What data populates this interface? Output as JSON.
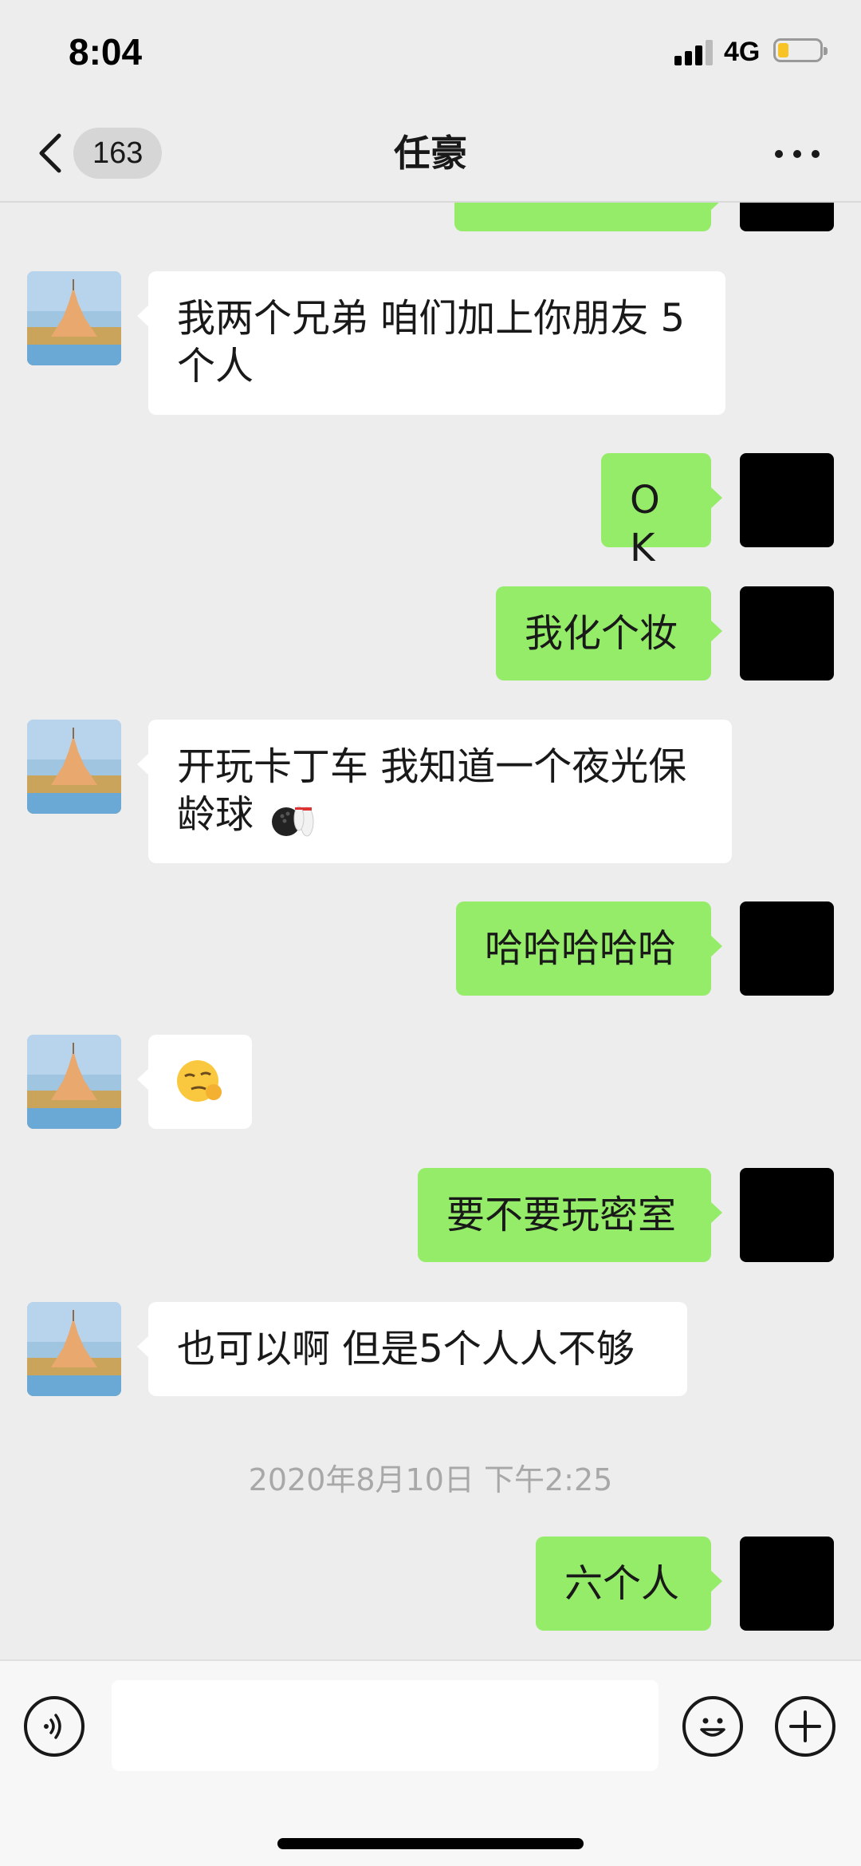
{
  "status_bar": {
    "time": "8:04",
    "network": "4G",
    "battery_level_fraction": 0.25,
    "battery_color": "#f7c325"
  },
  "nav": {
    "unread_count": "163",
    "title": "任豪",
    "back_icon": "chevron-left-icon",
    "more_icon": "more-dots-icon"
  },
  "messages": [
    {
      "side": "in",
      "text": "我两个兄弟 咱们加上你朋友 5个人"
    },
    {
      "side": "out",
      "text": "OK"
    },
    {
      "side": "out",
      "text": "我化个妆"
    },
    {
      "side": "in",
      "text": "开玩卡丁车 我知道一个夜光保龄球",
      "emoji": "bowling-emoji"
    },
    {
      "side": "out",
      "text": "哈哈哈哈哈"
    },
    {
      "side": "in",
      "emoji": "smirk-face-emoji"
    },
    {
      "side": "out",
      "text": "要不要玩密室"
    },
    {
      "side": "in",
      "text": "也可以啊 但是5个人人不够"
    },
    {
      "side": "out",
      "text": "六个人"
    }
  ],
  "timestamp": "2020年8月10日 下午2:25",
  "input_bar": {
    "voice_icon": "voice-icon",
    "emoji_icon": "emoji-icon",
    "plus_icon": "plus-icon",
    "message_value": ""
  },
  "colors": {
    "outgoing_bubble": "#95ec69",
    "incoming_bubble": "#ffffff",
    "background": "#ededed"
  }
}
